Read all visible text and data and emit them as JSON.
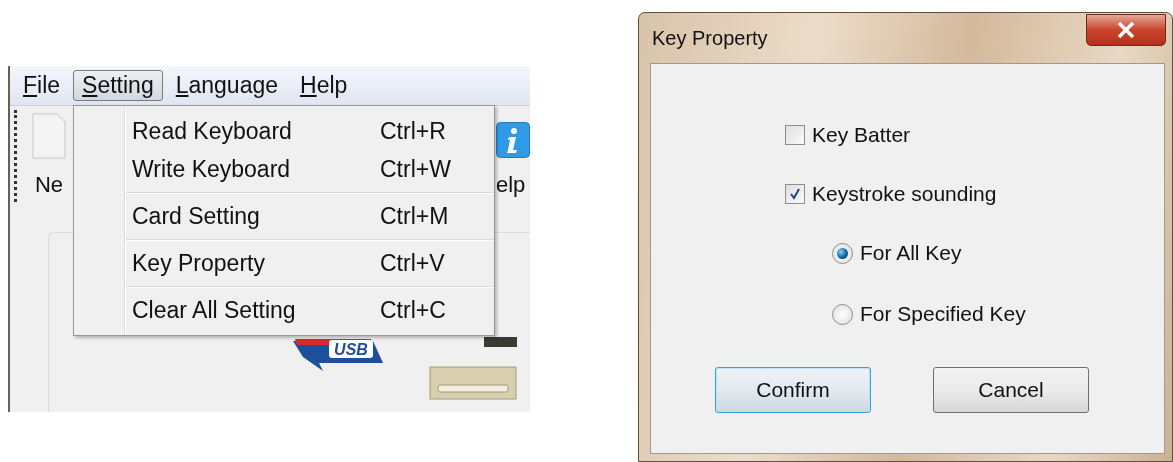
{
  "menu_window": {
    "menu_bar": [
      {
        "label": "File",
        "selected": false
      },
      {
        "label": "Setting",
        "selected": true
      },
      {
        "label": "Language",
        "selected": false
      },
      {
        "label": "Help",
        "selected": false
      }
    ],
    "usb_logo_text": "USB",
    "toolbar": [
      {
        "kind": "document",
        "label": "Ne"
      },
      {
        "kind": "info",
        "label": "elp"
      }
    ],
    "dropdown": [
      [
        {
          "label": "Read Keyboard",
          "shortcut": "Ctrl+R"
        },
        {
          "label": "Write Keyboard",
          "shortcut": "Ctrl+W"
        }
      ],
      [
        {
          "label": "Card Setting",
          "shortcut": "Ctrl+M"
        }
      ],
      [
        {
          "label": "Key Property",
          "shortcut": "Ctrl+V"
        }
      ],
      [
        {
          "label": "Clear All Setting",
          "shortcut": "Ctrl+C"
        }
      ]
    ]
  },
  "dialog": {
    "title": "Key Property",
    "options": [
      {
        "kind": "checkbox",
        "label": "Key Batter",
        "checked": false
      },
      {
        "kind": "checkbox",
        "label": "Keystroke sounding",
        "checked": true
      },
      {
        "kind": "radio",
        "label": "For All Key",
        "selected": true
      },
      {
        "kind": "radio",
        "label": "For Specified Key",
        "selected": false
      }
    ],
    "buttons": [
      {
        "label": "Confirm",
        "focused": true
      },
      {
        "label": "Cancel",
        "focused": false
      }
    ]
  }
}
